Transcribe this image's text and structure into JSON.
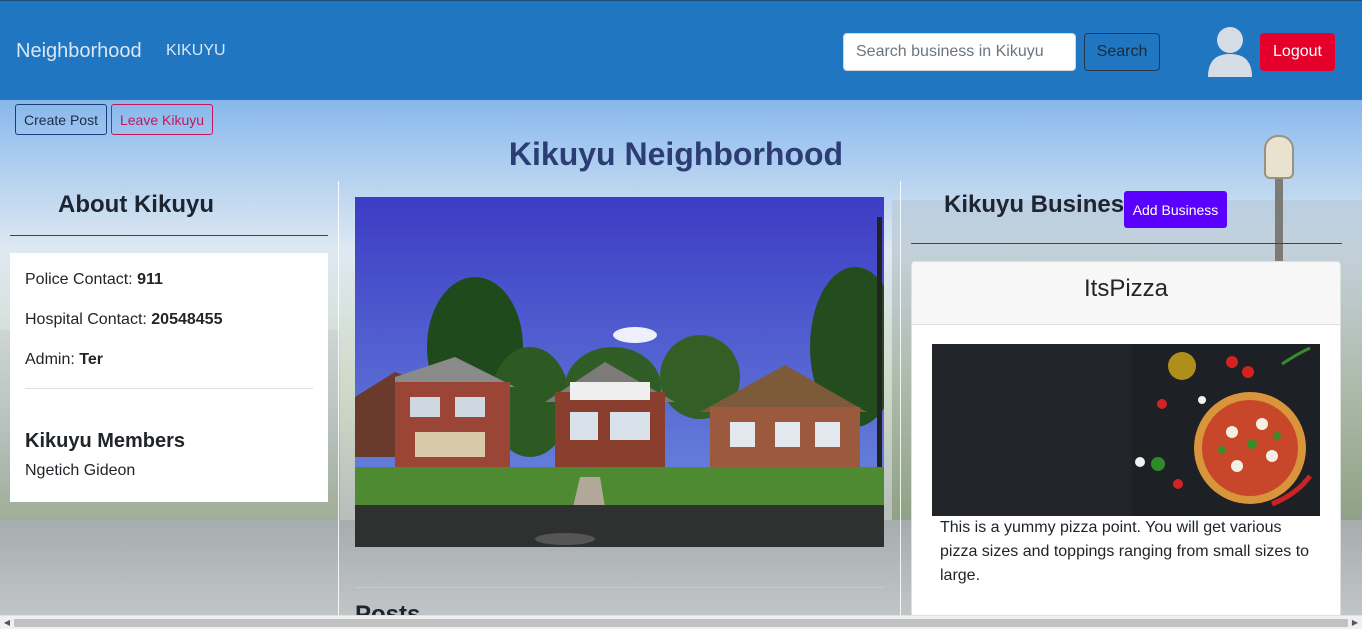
{
  "navbar": {
    "brand": "Neighborhood",
    "link": "KIKUYU",
    "search_placeholder": "Search business in Kikuyu",
    "search_label": "Search",
    "logout_label": "Logout",
    "color": "#2176c2"
  },
  "actions": {
    "create_post": "Create Post",
    "leave": "Leave Kikuyu"
  },
  "page_title": "Kikuyu Neighborhood",
  "about": {
    "title": "About Kikuyu",
    "police_label": "Police Contact: ",
    "police_value": "911",
    "hospital_label": "Hospital Contact: ",
    "hospital_value": "20548455",
    "admin_label": "Admin: ",
    "admin_value": "Ter",
    "members_title": "Kikuyu Members",
    "members": [
      "Ngetich Gideon"
    ]
  },
  "posts": {
    "title": "Posts"
  },
  "business": {
    "title": "Kikuyu Business",
    "add_label": "Add Business",
    "add_color": "#5a00ff",
    "items": [
      {
        "name": "ItsPizza",
        "description": "This is a yummy pizza point. You will get various pizza sizes and toppings ranging from small sizes to large."
      }
    ]
  },
  "icons": {
    "avatar": "user-avatar-icon",
    "scroll_left": "arrow-left-icon",
    "scroll_right": "arrow-right-icon"
  },
  "colors": {
    "logout": "#e4002b",
    "leave": "#c2185b",
    "title": "#2c3d74"
  }
}
